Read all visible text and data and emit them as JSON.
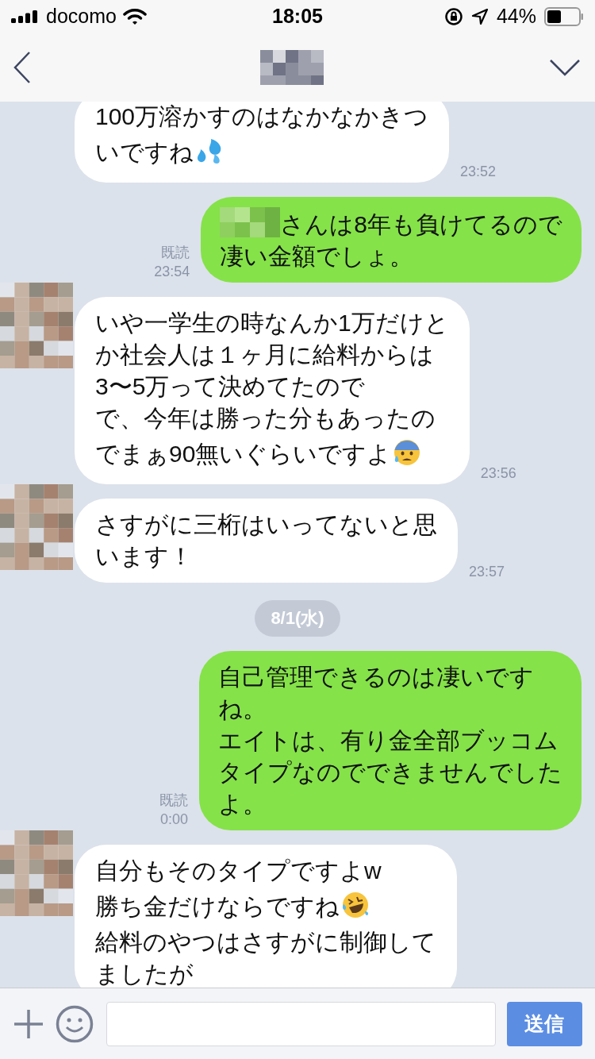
{
  "status_bar": {
    "carrier": "docomo",
    "time": "18:05",
    "battery": "44%"
  },
  "messages": [
    {
      "kind": "incoming",
      "avatar": false,
      "lines": [
        {
          "kind": "text",
          "text": "100万溶かすのはなかなかきつ"
        },
        {
          "kind": "text_with_drops",
          "text": "いですね"
        }
      ],
      "time": "23:52"
    },
    {
      "kind": "outgoing",
      "read": "既読",
      "time": "23:54",
      "lines": [
        {
          "kind": "blurred_name_then_text",
          "text": "さんは8年も負けてるので"
        },
        {
          "kind": "text",
          "text": "凄い金額でしょ。"
        }
      ]
    },
    {
      "kind": "incoming",
      "avatar": true,
      "lines": [
        {
          "kind": "text",
          "text": "いや一学生の時なんか1万だけと"
        },
        {
          "kind": "text",
          "text": "か社会人は１ヶ月に給料からは"
        },
        {
          "kind": "text",
          "text": "3〜5万って決めてたので"
        },
        {
          "kind": "text",
          "text": "で、今年は勝った分もあったの"
        },
        {
          "kind": "text_with_anxious_face",
          "text": "でまぁ90無いぐらいですよ"
        }
      ],
      "time": "23:56"
    },
    {
      "kind": "incoming",
      "avatar": true,
      "lines": [
        {
          "kind": "text",
          "text": "さすがに三桁はいってないと思"
        },
        {
          "kind": "text",
          "text": "います！"
        }
      ],
      "time": "23:57"
    },
    {
      "kind": "date",
      "label": "8/1(水)"
    },
    {
      "kind": "outgoing",
      "read": "既読",
      "time": "0:00",
      "lines": [
        {
          "kind": "text",
          "text": "自己管理できるのは凄いです"
        },
        {
          "kind": "text",
          "text": "ね。"
        },
        {
          "kind": "text",
          "text": "エイトは、有り金全部ブッコム"
        },
        {
          "kind": "text",
          "text": "タイプなのでできませんでした"
        },
        {
          "kind": "text",
          "text": "よ。"
        }
      ]
    },
    {
      "kind": "incoming",
      "avatar": true,
      "lines": [
        {
          "kind": "text",
          "text": "自分もそのタイプですよw"
        },
        {
          "kind": "text_with_laughing_face",
          "text": "勝ち金だけならですね"
        },
        {
          "kind": "text",
          "text": "給料のやつはさすがに制御して"
        },
        {
          "kind": "text",
          "text": "ましたが"
        }
      ]
    }
  ],
  "composer": {
    "send": "送信"
  }
}
